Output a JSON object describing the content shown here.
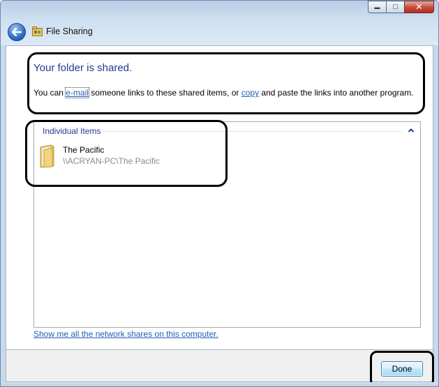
{
  "window": {
    "title": "File Sharing",
    "minimize_label": "▬",
    "maximize_label": "□",
    "close_label": "✕"
  },
  "header": {
    "heading": "Your folder is shared.",
    "desc_prefix": "You can ",
    "email_link": "e-mail",
    "desc_middle": " someone links to these shared items, or ",
    "copy_link": "copy",
    "desc_suffix": " and paste the links into another program."
  },
  "items": {
    "group_label": "Individual Items",
    "list": [
      {
        "name": "The Pacific",
        "path": "\\\\ACRYAN-PC\\The Pacific"
      }
    ]
  },
  "links": {
    "network_shares": "Show me all the network shares on this computer."
  },
  "footer": {
    "done_label": "Done"
  },
  "colors": {
    "heading": "#1f3a93",
    "link": "#1f5eb8",
    "annotation": "#000000"
  }
}
